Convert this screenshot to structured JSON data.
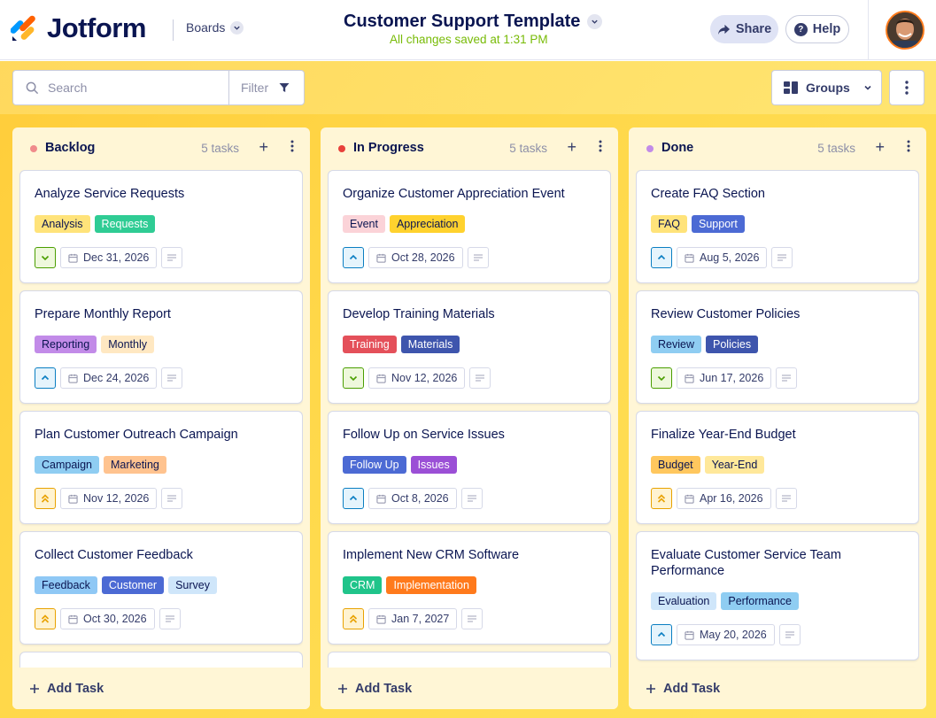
{
  "header": {
    "logo_text": "Jotform",
    "boards_label": "Boards",
    "title": "Customer Support Template",
    "saved_status": "All changes saved at 1:31 PM",
    "share_label": "Share",
    "help_label": "Help"
  },
  "toolbar": {
    "search_placeholder": "Search",
    "filter_label": "Filter",
    "groups_label": "Groups"
  },
  "colors": {
    "brand_orange": "#ff6100",
    "brand_yellow": "#ffb629",
    "brand_blue": "#0099ff",
    "saved_green": "#78bb07",
    "canvas_yellow": "#ffd84a"
  },
  "columns": [
    {
      "title": "Backlog",
      "count": "5 tasks",
      "dot": "#f08b8b",
      "add_task": "Add Task",
      "cards": [
        {
          "title": "Analyze Service Requests",
          "tags": [
            {
              "label": "Analysis",
              "bg": "#ffe37a",
              "fg": "#0a1551"
            },
            {
              "label": "Requests",
              "bg": "#2fcc94",
              "fg": "#ffffff"
            }
          ],
          "priority": "low",
          "date": "Dec 31, 2026"
        },
        {
          "title": "Prepare Monthly Report",
          "tags": [
            {
              "label": "Reporting",
              "bg": "#c28be8",
              "fg": "#0a1551"
            },
            {
              "label": "Monthly",
              "bg": "#ffe8c2",
              "fg": "#0a1551"
            }
          ],
          "priority": "medium",
          "date": "Dec 24, 2026"
        },
        {
          "title": "Plan Customer Outreach Campaign",
          "tags": [
            {
              "label": "Campaign",
              "bg": "#8fcdf2",
              "fg": "#0a1551"
            },
            {
              "label": "Marketing",
              "bg": "#ffc38f",
              "fg": "#0a1551"
            }
          ],
          "priority": "high",
          "date": "Nov 12, 2026"
        },
        {
          "title": "Collect Customer Feedback",
          "tags": [
            {
              "label": "Feedback",
              "bg": "#8fc8f5",
              "fg": "#0a1551"
            },
            {
              "label": "Customer",
              "bg": "#4c6ad4",
              "fg": "#ffffff"
            },
            {
              "label": "Survey",
              "bg": "#cfe6fa",
              "fg": "#0a1551"
            }
          ],
          "priority": "high",
          "date": "Oct 30, 2026"
        }
      ]
    },
    {
      "title": "In Progress",
      "count": "5 tasks",
      "dot": "#e8413b",
      "add_task": "Add Task",
      "cards": [
        {
          "title": "Organize Customer Appreciation Event",
          "tags": [
            {
              "label": "Event",
              "bg": "#fbd3d8",
              "fg": "#0a1551"
            },
            {
              "label": "Appreciation",
              "bg": "#ffd22e",
              "fg": "#0a1551"
            }
          ],
          "priority": "medium",
          "date": "Oct 28, 2026"
        },
        {
          "title": "Develop Training Materials",
          "tags": [
            {
              "label": "Training",
              "bg": "#e4505a",
              "fg": "#ffffff"
            },
            {
              "label": "Materials",
              "bg": "#3e55ad",
              "fg": "#ffffff"
            }
          ],
          "priority": "low",
          "date": "Nov 12, 2026"
        },
        {
          "title": "Follow Up on Service Issues",
          "tags": [
            {
              "label": "Follow Up",
              "bg": "#4c6ad4",
              "fg": "#ffffff"
            },
            {
              "label": "Issues",
              "bg": "#9b4fd6",
              "fg": "#ffffff"
            }
          ],
          "priority": "medium",
          "date": "Oct 8, 2026"
        },
        {
          "title": "Implement New CRM Software",
          "tags": [
            {
              "label": "CRM",
              "bg": "#20c48a",
              "fg": "#ffffff"
            },
            {
              "label": "Implementation",
              "bg": "#ff7a1c",
              "fg": "#ffffff"
            }
          ],
          "priority": "high",
          "date": "Jan 7, 2027"
        }
      ]
    },
    {
      "title": "Done",
      "count": "5 tasks",
      "dot": "#c28be8",
      "add_task": "Add Task",
      "cards": [
        {
          "title": "Create FAQ Section",
          "tags": [
            {
              "label": "FAQ",
              "bg": "#ffe37a",
              "fg": "#0a1551"
            },
            {
              "label": "Support",
              "bg": "#4c6ad4",
              "fg": "#ffffff"
            }
          ],
          "priority": "medium",
          "date": "Aug 5, 2026"
        },
        {
          "title": "Review Customer Policies",
          "tags": [
            {
              "label": "Review",
              "bg": "#8fcdf2",
              "fg": "#0a1551"
            },
            {
              "label": "Policies",
              "bg": "#3e55ad",
              "fg": "#ffffff"
            }
          ],
          "priority": "low",
          "date": "Jun 17, 2026"
        },
        {
          "title": "Finalize Year-End Budget",
          "tags": [
            {
              "label": "Budget",
              "bg": "#ffc75e",
              "fg": "#0a1551"
            },
            {
              "label": "Year-End",
              "bg": "#ffe89a",
              "fg": "#0a1551"
            }
          ],
          "priority": "high",
          "date": "Apr 16, 2026"
        },
        {
          "title": "Evaluate Customer Service Team Performance",
          "tags": [
            {
              "label": "Evaluation",
              "bg": "#cfe6fa",
              "fg": "#0a1551"
            },
            {
              "label": "Performance",
              "bg": "#8fcdf2",
              "fg": "#0a1551"
            }
          ],
          "priority": "medium",
          "date": "May 20, 2026"
        }
      ]
    }
  ]
}
